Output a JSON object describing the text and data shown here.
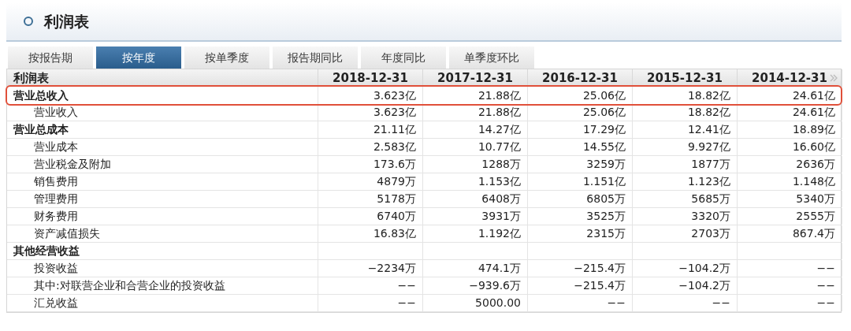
{
  "panel": {
    "title": "利润表"
  },
  "tabs": [
    {
      "label": "按报告期",
      "selected": false
    },
    {
      "label": "按年度",
      "selected": true
    },
    {
      "label": "按单季度",
      "selected": false
    },
    {
      "label": "报告期同比",
      "selected": false
    },
    {
      "label": "年度同比",
      "selected": false
    },
    {
      "label": "单季度环比",
      "selected": false
    }
  ],
  "table": {
    "columns": [
      "利润表",
      "2018-12-31",
      "2017-12-31",
      "2016-12-31",
      "2015-12-31",
      "2014-12-31"
    ],
    "rows": [
      {
        "label": "营业总收入",
        "highlighted": true,
        "values": [
          "3.623亿",
          "21.88亿",
          "25.06亿",
          "18.82亿",
          "24.61亿"
        ],
        "children": [
          {
            "label": "营业收入",
            "values": [
              "3.623亿",
              "21.88亿",
              "25.06亿",
              "18.82亿",
              "24.61亿"
            ]
          }
        ]
      },
      {
        "label": "营业总成本",
        "highlighted": false,
        "values": [
          "21.11亿",
          "14.27亿",
          "17.29亿",
          "12.41亿",
          "18.89亿"
        ],
        "children": [
          {
            "label": "营业成本",
            "values": [
              "2.583亿",
              "10.77亿",
              "14.55亿",
              "9.927亿",
              "16.60亿"
            ]
          },
          {
            "label": "营业税金及附加",
            "values": [
              "173.6万",
              "1288万",
              "3259万",
              "1877万",
              "2636万"
            ]
          },
          {
            "label": "销售费用",
            "values": [
              "4879万",
              "1.153亿",
              "1.151亿",
              "1.123亿",
              "1.148亿"
            ]
          },
          {
            "label": "管理费用",
            "values": [
              "5178万",
              "6408万",
              "6805万",
              "5685万",
              "5340万"
            ]
          },
          {
            "label": "财务费用",
            "values": [
              "6740万",
              "3931万",
              "3525万",
              "3320万",
              "2555万"
            ]
          },
          {
            "label": "资产减值损失",
            "values": [
              "16.83亿",
              "1.192亿",
              "2315万",
              "2703万",
              "867.4万"
            ]
          }
        ]
      },
      {
        "label": "其他经营收益",
        "highlighted": false,
        "children": [
          {
            "label": "投资收益",
            "values": [
              "−2234万",
              "474.1万",
              "−215.4万",
              "−104.2万",
              "−−"
            ]
          },
          {
            "label": "其中:对联营企业和合营企业的投资收益",
            "values": [
              "−−",
              "−939.6万",
              "−215.4万",
              "−104.2万",
              "−−"
            ]
          },
          {
            "label": "汇兑收益",
            "values": [
              "−−",
              "5000.00",
              "−−",
              "−−",
              "−−"
            ]
          }
        ]
      }
    ]
  }
}
